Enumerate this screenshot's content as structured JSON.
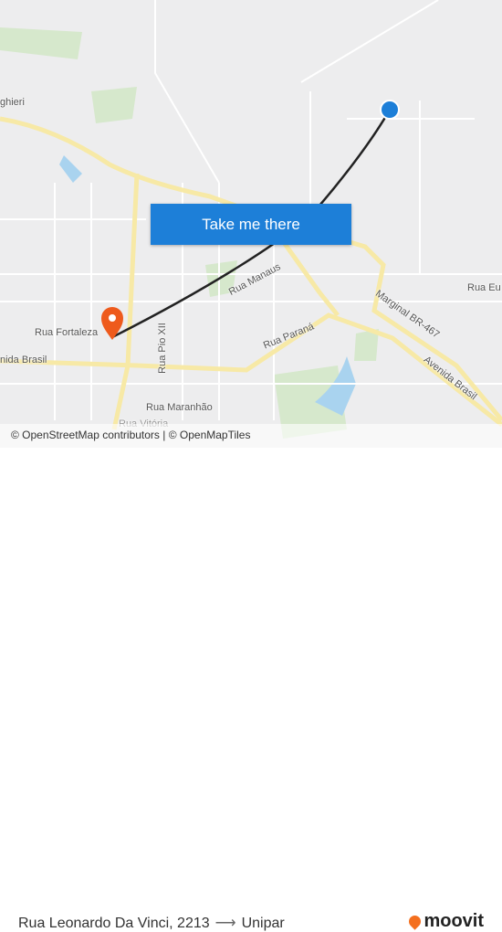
{
  "map": {
    "street_labels": [
      "ghieri",
      "Rua Manaus",
      "Rua Pio XII",
      "Rua Fortaleza",
      "nida Brasil",
      "Rua Paraná",
      "Marginal BR-467",
      "Avenida Brasil",
      "Rua Eu",
      "Rua Maranhão",
      "Rua Vitória"
    ],
    "origin_marker_color": "#ee5a1c",
    "destination_marker_color": "#1d7fd8",
    "route_color": "#222222",
    "attribution": "© OpenStreetMap contributors | © OpenMapTiles"
  },
  "cta": {
    "label": "Take me there"
  },
  "footer": {
    "origin": "Rua Leonardo Da Vinci, 2213",
    "arrow": "⟶",
    "destination": "Unipar",
    "brand": "moovit"
  }
}
